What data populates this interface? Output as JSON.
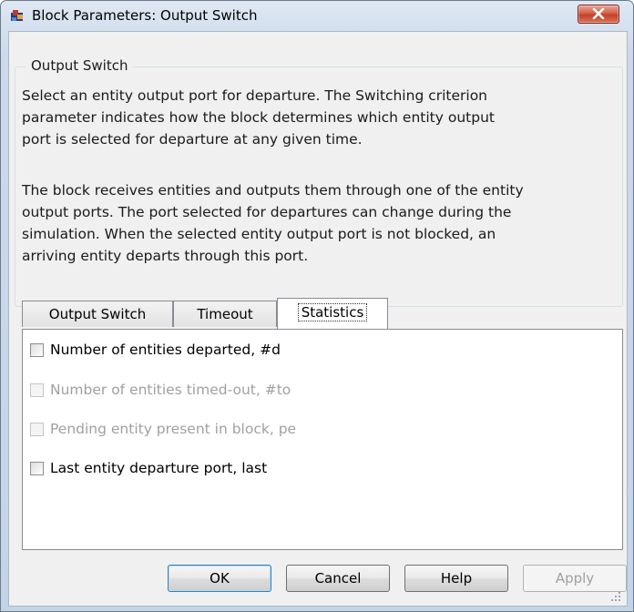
{
  "window": {
    "title": "Block Parameters: Output Switch",
    "accent": "#c1412a"
  },
  "group": {
    "legend": "Output Switch",
    "description_1": "Select an entity output port for departure. The Switching criterion\nparameter indicates how the block determines which entity output\nport is selected for departure at any given time.",
    "description_2": "The block receives entities and outputs them through one of the entity\noutput ports. The port selected for departures can change during the\nsimulation. When the selected entity output port is not blocked, an\narriving entity departs through this port."
  },
  "tabs": [
    {
      "label": "Output Switch",
      "active": false
    },
    {
      "label": "Timeout",
      "active": false
    },
    {
      "label": "Statistics",
      "active": true
    }
  ],
  "statistics": {
    "options": [
      {
        "label": "Number of entities departed, #d",
        "checked": false,
        "enabled": true
      },
      {
        "label": "Number of entities timed-out, #to",
        "checked": false,
        "enabled": false
      },
      {
        "label": "Pending entity present in block, pe",
        "checked": false,
        "enabled": false
      },
      {
        "label": "Last entity departure port, last",
        "checked": false,
        "enabled": true
      }
    ]
  },
  "buttons": {
    "ok": "OK",
    "cancel": "Cancel",
    "help": "Help",
    "apply": "Apply"
  }
}
